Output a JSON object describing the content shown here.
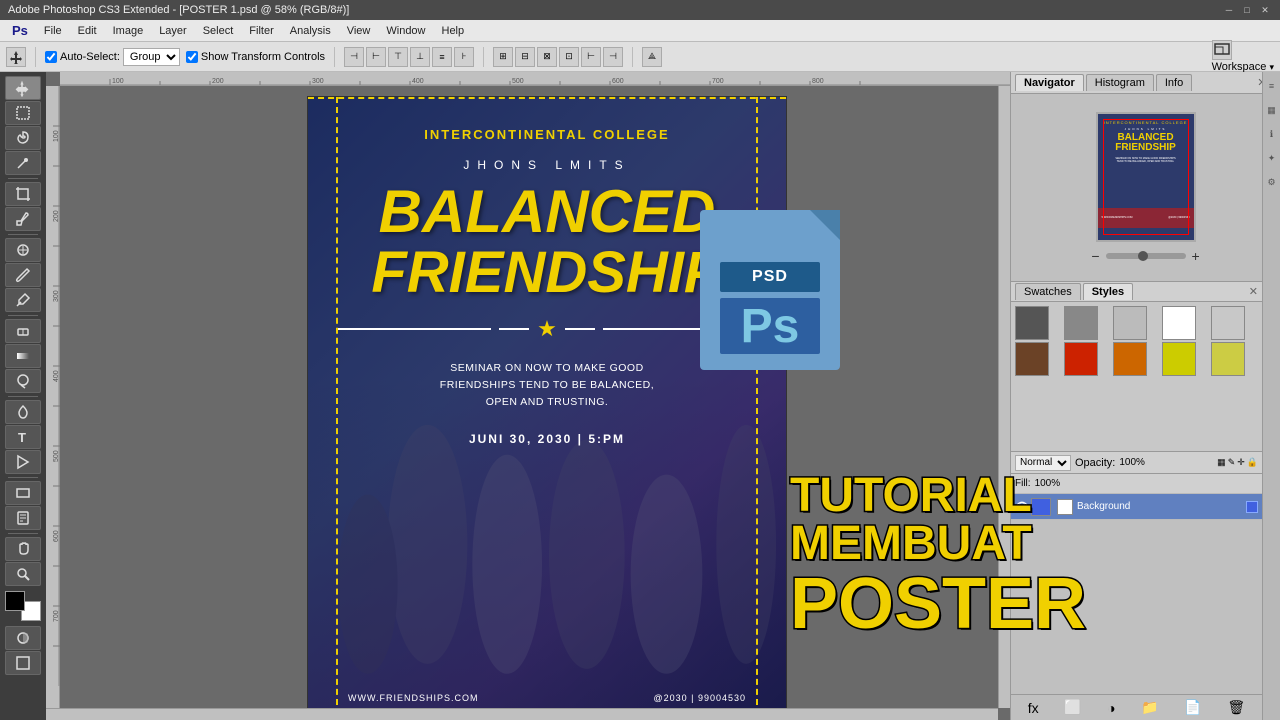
{
  "titlebar": {
    "title": "Adobe Photoshop CS3 Extended - [POSTER 1.psd @ 58% (RGB/8#)]",
    "minimize": "─",
    "maximize": "□",
    "close": "✕"
  },
  "menubar": {
    "items": [
      "Ps",
      "File",
      "Edit",
      "Image",
      "Layer",
      "Select",
      "Filter",
      "Analysis",
      "View",
      "Window",
      "Help"
    ]
  },
  "toolbar": {
    "autoselect_label": "Auto-Select:",
    "group_option": "Group",
    "show_transform_label": "Show Transform Controls",
    "workspace_label": "Workspace"
  },
  "poster": {
    "college": "INTERCONTINENTAL COLLEGE",
    "author": "JHONS LMITS",
    "title1": "BALANCED",
    "title2": "FRIENDSHIP",
    "description": "SEMINAR ON NOW TO MAKE GOOD\nFRIENDSHIPS TEND TO BE BALANCED,\nOPEN AND TRUSTING.",
    "date": "JUNI 30, 2030 | 5:PM",
    "website": "WWW.FRIENDSHIPS.COM",
    "contact": "@2030 | 99004530",
    "star": "★"
  },
  "psd_icon": {
    "label_top": "PSD",
    "label_ps": "Ps"
  },
  "tutorial": {
    "line1": "TUTORIAL MEMBUAT",
    "line2": "POSTER"
  },
  "navigator": {
    "tab1": "Navigator",
    "tab2": "Histogram",
    "tab3": "Info",
    "thumb_college": "INTERCONTINENTAL COLLEGE",
    "thumb_author": "JHONS LMITS",
    "thumb_title": "BALANCED\nFRIENDSHIP",
    "thumb_desc": "SEMINAR ON NOW TO MAKE GOOD FRIENDSHIPS\nTEND TO BE BALANCED, OPEN AND TRUSTING.",
    "thumb_website": "WWW.FRIENDSHIPS.COM",
    "thumb_contact": "@2030 | 99004530"
  },
  "styles_panel": {
    "tab1": "Swatches",
    "tab2": "Styles",
    "swatches": [
      {
        "class": "sw-gray-dark"
      },
      {
        "class": "sw-gray-med"
      },
      {
        "class": "sw-gray-light"
      },
      {
        "class": "sw-white"
      },
      {
        "class": "sw-white"
      },
      {
        "class": "sw-brown-dark"
      },
      {
        "class": "sw-red"
      },
      {
        "class": "sw-orange"
      },
      {
        "class": "sw-yellow"
      },
      {
        "class": "sw-yellow"
      }
    ]
  },
  "layers_panel": {
    "blend_label": "Normal",
    "opacity_label": "Opacity:",
    "opacity_value": "100%",
    "fill_label": "Fill:",
    "fill_value": "100%",
    "layers": [
      {
        "name": "Background",
        "active": true
      }
    ]
  },
  "zoom": {
    "level": "58%"
  }
}
